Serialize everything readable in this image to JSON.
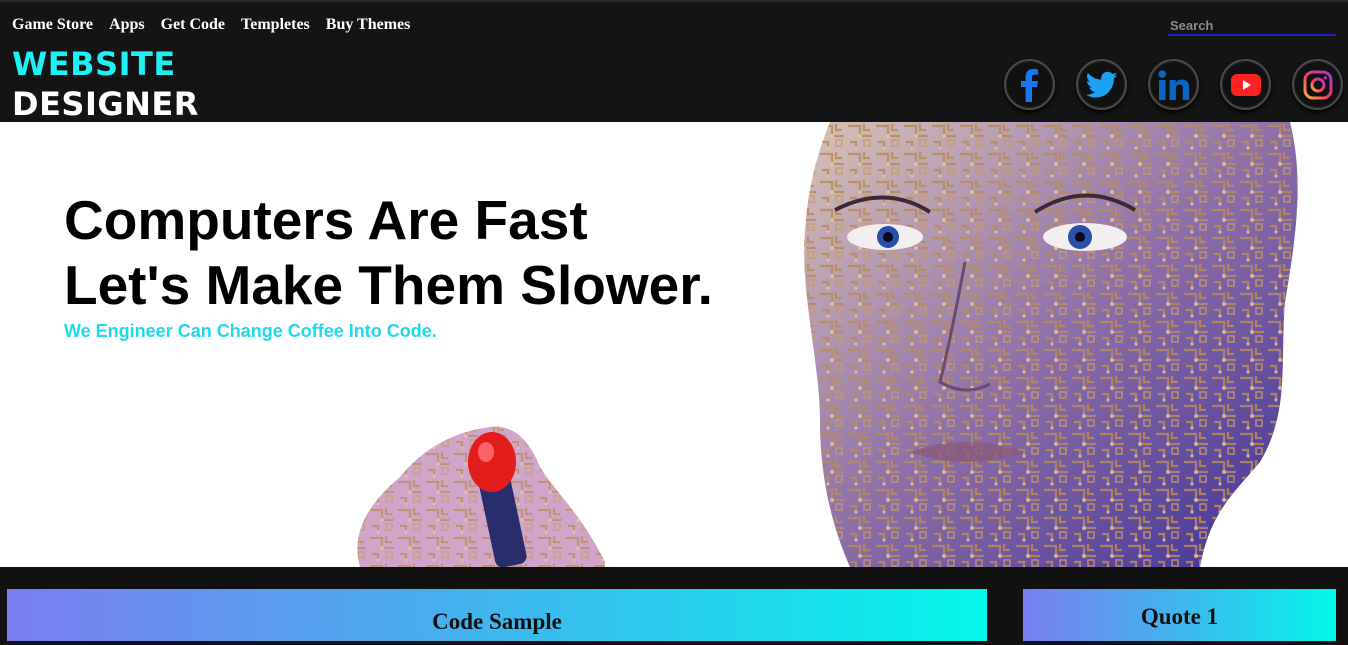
{
  "nav": {
    "items": [
      "Game Store",
      "Apps",
      "Get Code",
      "Templetes",
      "Buy Themes"
    ]
  },
  "search": {
    "placeholder": "Search",
    "value": ""
  },
  "logo": {
    "line1": "WEBSITE",
    "line2": "DESIGNER"
  },
  "socials": [
    {
      "name": "facebook-icon",
      "color": "#1877f2"
    },
    {
      "name": "twitter-icon",
      "color": "#1da1f2"
    },
    {
      "name": "linkedin-icon",
      "color": "#0a66c2"
    },
    {
      "name": "youtube-icon",
      "color": "#ff0000"
    },
    {
      "name": "instagram-icon",
      "color": "#e1306c"
    }
  ],
  "hero": {
    "title_line1": "Computers Are Fast",
    "title_line2": "Let's Make Them Slower.",
    "subtitle": "We Engineer Can Change Coffee Into Code."
  },
  "cards": {
    "code_title": "Code Sample",
    "quote_title": "Quote 1"
  },
  "colors": {
    "accent": "#1ff0f4",
    "header_bg": "#141414",
    "gradient_start": "#7b7ef0",
    "gradient_end": "#03f7ea"
  }
}
